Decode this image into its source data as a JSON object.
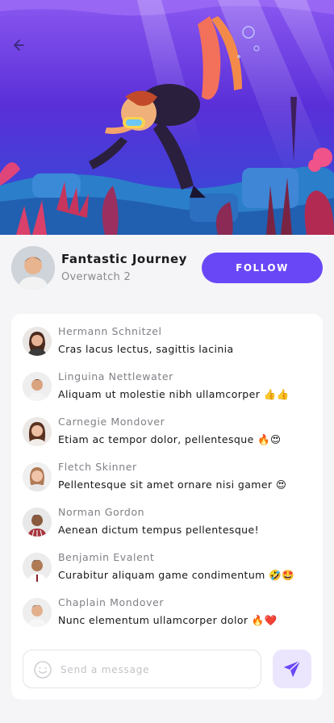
{
  "hero": {
    "image": "underwater-diver-illustration",
    "back_icon": "arrow-left-icon"
  },
  "profile": {
    "name": "Fantastic Journey",
    "subtitle": "Overwatch 2",
    "follow_label": "FOLLOW"
  },
  "chat": {
    "messages": [
      {
        "author": "Hermann Schnitzel",
        "text": "Cras lacus lectus, sagittis lacinia"
      },
      {
        "author": "Linguina Nettlewater",
        "text": "Aliquam ut molestie nibh ullamcorper 👍👍"
      },
      {
        "author": "Carnegie Mondover",
        "text": "Etiam ac tempor dolor, pellentesque 🔥😍"
      },
      {
        "author": "Fletch Skinner",
        "text": "Pellentesque sit amet ornare nisi gamer 😍"
      },
      {
        "author": "Norman Gordon",
        "text": "Aenean dictum tempus pellentesque!"
      },
      {
        "author": "Benjamin Evalent",
        "text": "Curabitur aliquam game condimentum 🤣🤩"
      },
      {
        "author": "Chaplain Mondover",
        "text": "Nunc elementum ullamcorper dolor 🔥❤️"
      }
    ],
    "input_placeholder": "Send a message",
    "emoji_icon": "smiley-icon",
    "send_icon": "paper-plane-icon"
  },
  "colors": {
    "accent": "#6a47f6",
    "send_bg": "#ebe6fd"
  }
}
